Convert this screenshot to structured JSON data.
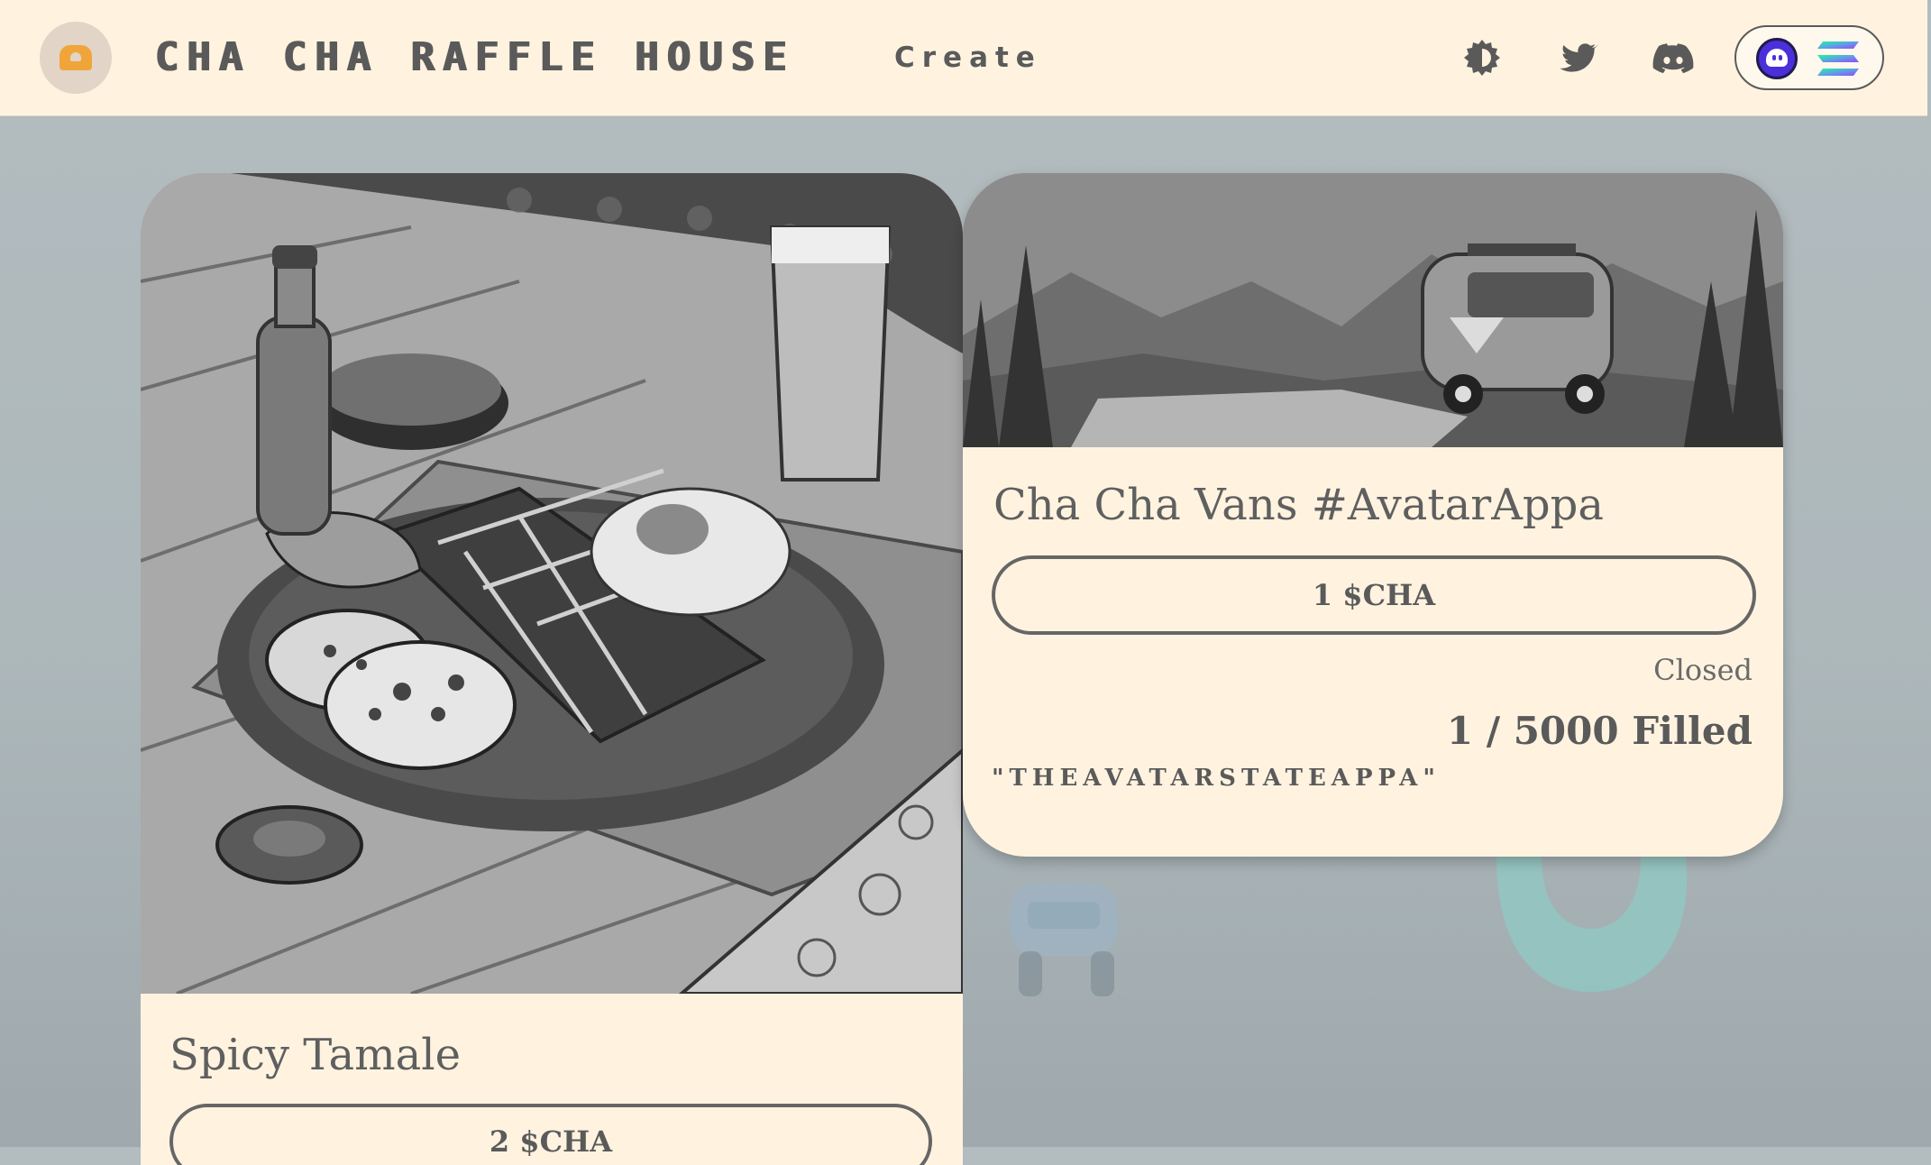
{
  "header": {
    "brand": "CHA CHA RAFFLE HOUSE",
    "create_label": "Create",
    "icons": [
      "theme-toggle-icon",
      "twitter-icon",
      "discord-icon"
    ],
    "wallet": {
      "icons": [
        "phantom-wallet-icon",
        "solana-icon"
      ]
    }
  },
  "raffles": [
    {
      "title": "Spicy Tamale",
      "price": "2 $CHA"
    },
    {
      "title": "Cha Cha Vans #AvatarAppa",
      "price": "1 $CHA",
      "status": "Closed",
      "filled": "1 / 5000 Filled",
      "handle": "\"THEAVATARSTATEAPPA\""
    }
  ],
  "colors": {
    "header_bg": "#fff3e0",
    "card_bg": "#fff3e0",
    "page_bg": "#b3bcbf",
    "text": "#5a5a5a",
    "logo_accent": "#f0a53a"
  }
}
